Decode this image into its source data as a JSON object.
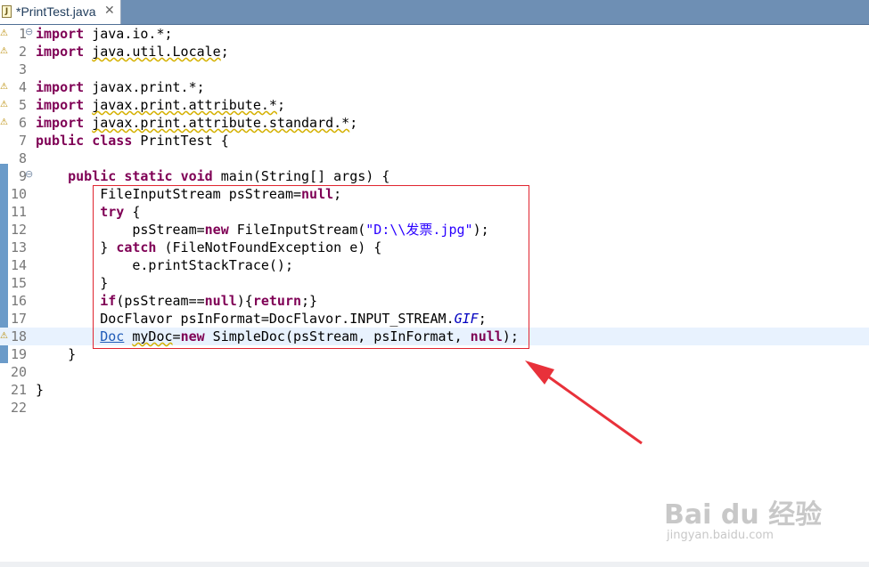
{
  "tab": {
    "title": "*PrintTest.java",
    "close": "✕"
  },
  "lines": [
    {
      "n": "1",
      "fold": "⊖",
      "marker": "⚠"
    },
    {
      "n": "2",
      "marker": "⚠"
    },
    {
      "n": "3"
    },
    {
      "n": "4",
      "marker": "⚠"
    },
    {
      "n": "5",
      "marker": "⚠"
    },
    {
      "n": "6",
      "marker": "⚠"
    },
    {
      "n": "7"
    },
    {
      "n": "8"
    },
    {
      "n": "9",
      "fold": "⊖"
    },
    {
      "n": "10"
    },
    {
      "n": "11"
    },
    {
      "n": "12"
    },
    {
      "n": "13"
    },
    {
      "n": "14"
    },
    {
      "n": "15"
    },
    {
      "n": "16"
    },
    {
      "n": "17"
    },
    {
      "n": "18",
      "marker": "⚠"
    },
    {
      "n": "19"
    },
    {
      "n": "20"
    },
    {
      "n": "21"
    },
    {
      "n": "22"
    }
  ],
  "code": {
    "l1_kw": "import",
    "l1_rest": " java.io.*;",
    "l2_kw": "import",
    "l2_sp": " ",
    "l2_pkg": "java.util.Locale",
    "l2_end": ";",
    "l4_kw": "import",
    "l4_rest": " javax.print.*;",
    "l5_kw": "import",
    "l5_sp": " ",
    "l5_pkg": "javax.print.attribute.*",
    "l5_end": ";",
    "l6_kw": "import",
    "l6_sp": " ",
    "l6_pkg": "javax.print.attribute.standard.*",
    "l6_end": ";",
    "l7_kw1": "public",
    "l7_sp": " ",
    "l7_kw2": "class",
    "l7_rest": " PrintTest {",
    "l9_ind": "    ",
    "l9_kw1": "public",
    "l9_s1": " ",
    "l9_kw2": "static",
    "l9_s2": " ",
    "l9_kw3": "void",
    "l9_rest": " main(String[] args) {",
    "l10_rest": "        FileInputStream psStream=",
    "l10_kw": "null",
    "l10_end": ";",
    "l11_ind": "        ",
    "l11_kw": "try",
    "l11_rest": " {",
    "l12_a": "            psStream=",
    "l12_kw": "new",
    "l12_b": " FileInputStream(",
    "l12_str": "\"D:\\\\发票.jpg\"",
    "l12_end": ");",
    "l13_a": "        } ",
    "l13_kw": "catch",
    "l13_b": " (FileNotFoundException e) {",
    "l14_rest": "            e.printStackTrace();",
    "l15_rest": "        }",
    "l16_ind": "        ",
    "l16_kw1": "if",
    "l16_a": "(psStream==",
    "l16_kw2": "null",
    "l16_b": "){",
    "l16_kw3": "return",
    "l16_c": ";}",
    "l17_a": "        DocFlavor psInFormat=DocFlavor.INPUT_STREAM.",
    "l17_it": "GIF",
    "l17_end": ";",
    "l18_ind": "        ",
    "l18_link": "Doc",
    "l18_sp": " ",
    "l18_var": "myDoc",
    "l18_eq": "=",
    "l18_kw1": "new",
    "l18_a": " SimpleDoc(psStream, psInFormat, ",
    "l18_kw2": "null",
    "l18_end": ");",
    "l19_rest": "    }",
    "l21_rest": "}"
  },
  "watermark": {
    "brand": "Bai du 经验",
    "url": "jingyan.baidu.com"
  },
  "colors": {
    "keyword": "#7f0055",
    "string": "#2a00ff",
    "highlight_box": "#e0242f",
    "arrow": "#e8313a",
    "current_line": "#e8f2fe"
  }
}
